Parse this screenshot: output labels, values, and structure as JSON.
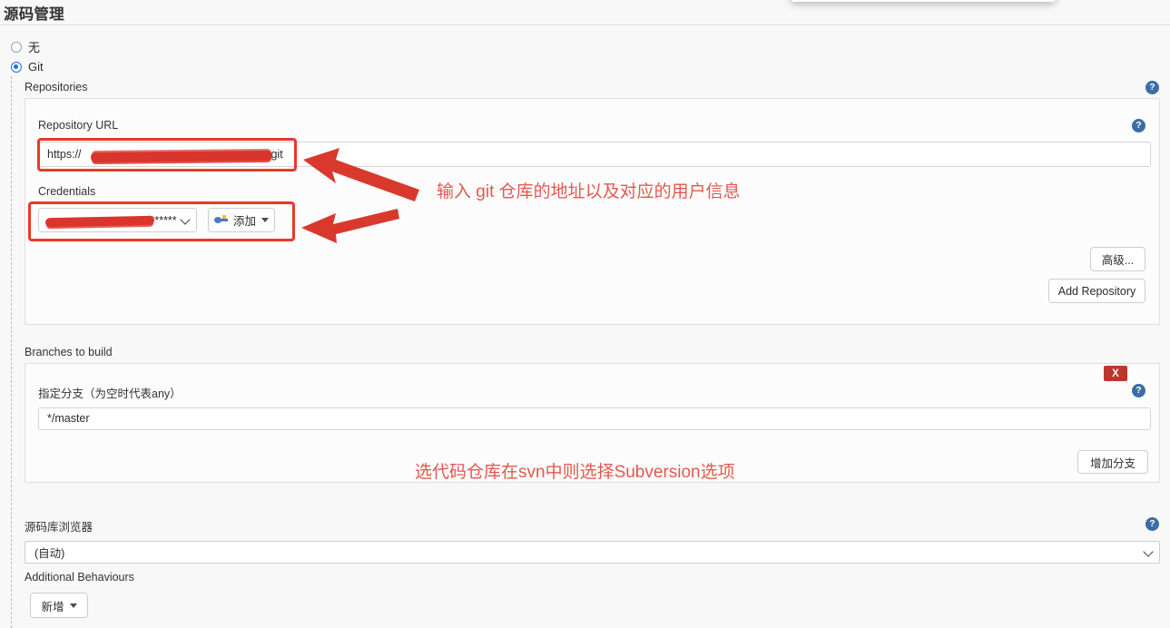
{
  "page": {
    "section_title": "源码管理"
  },
  "scm_options": [
    {
      "label": "无",
      "checked": false,
      "name": "none"
    },
    {
      "label": "Git",
      "checked": true,
      "name": "git"
    }
  ],
  "repositories": {
    "legend": "Repositories",
    "repository_url": {
      "label": "Repository URL",
      "value": "https://",
      "value_suffix": "r.git",
      "redacted": true
    },
    "credentials": {
      "label": "Credentials",
      "selected": "/******",
      "redacted": true,
      "add_button": "添加"
    },
    "advanced_button": "高级...",
    "add_repository_button": "Add Repository"
  },
  "branches": {
    "legend": "Branches to build",
    "branch_label": "指定分支（为空时代表any）",
    "branch_value": "*/master",
    "delete_badge": "X",
    "add_branch_button": "增加分支"
  },
  "repository_browser": {
    "label": "源码库浏览器",
    "selected": "(自动)"
  },
  "additional_behaviours": {
    "label": "Additional Behaviours",
    "add_button": "新增"
  },
  "annotations": [
    {
      "text": "输入 git 仓库的地址以及对应的用户信息",
      "name": "annotation-git-repo-info"
    },
    {
      "text": "选代码仓库在svn中则选择Subversion选项",
      "name": "annotation-svn-subversion"
    }
  ],
  "icons": {
    "help": "?"
  },
  "colors": {
    "annotation_red": "#e8392c",
    "annotation_text": "#e4584f",
    "radio_blue": "#1a73e8",
    "help_blue": "#3a6ea5",
    "delete_red": "#bf352c"
  }
}
